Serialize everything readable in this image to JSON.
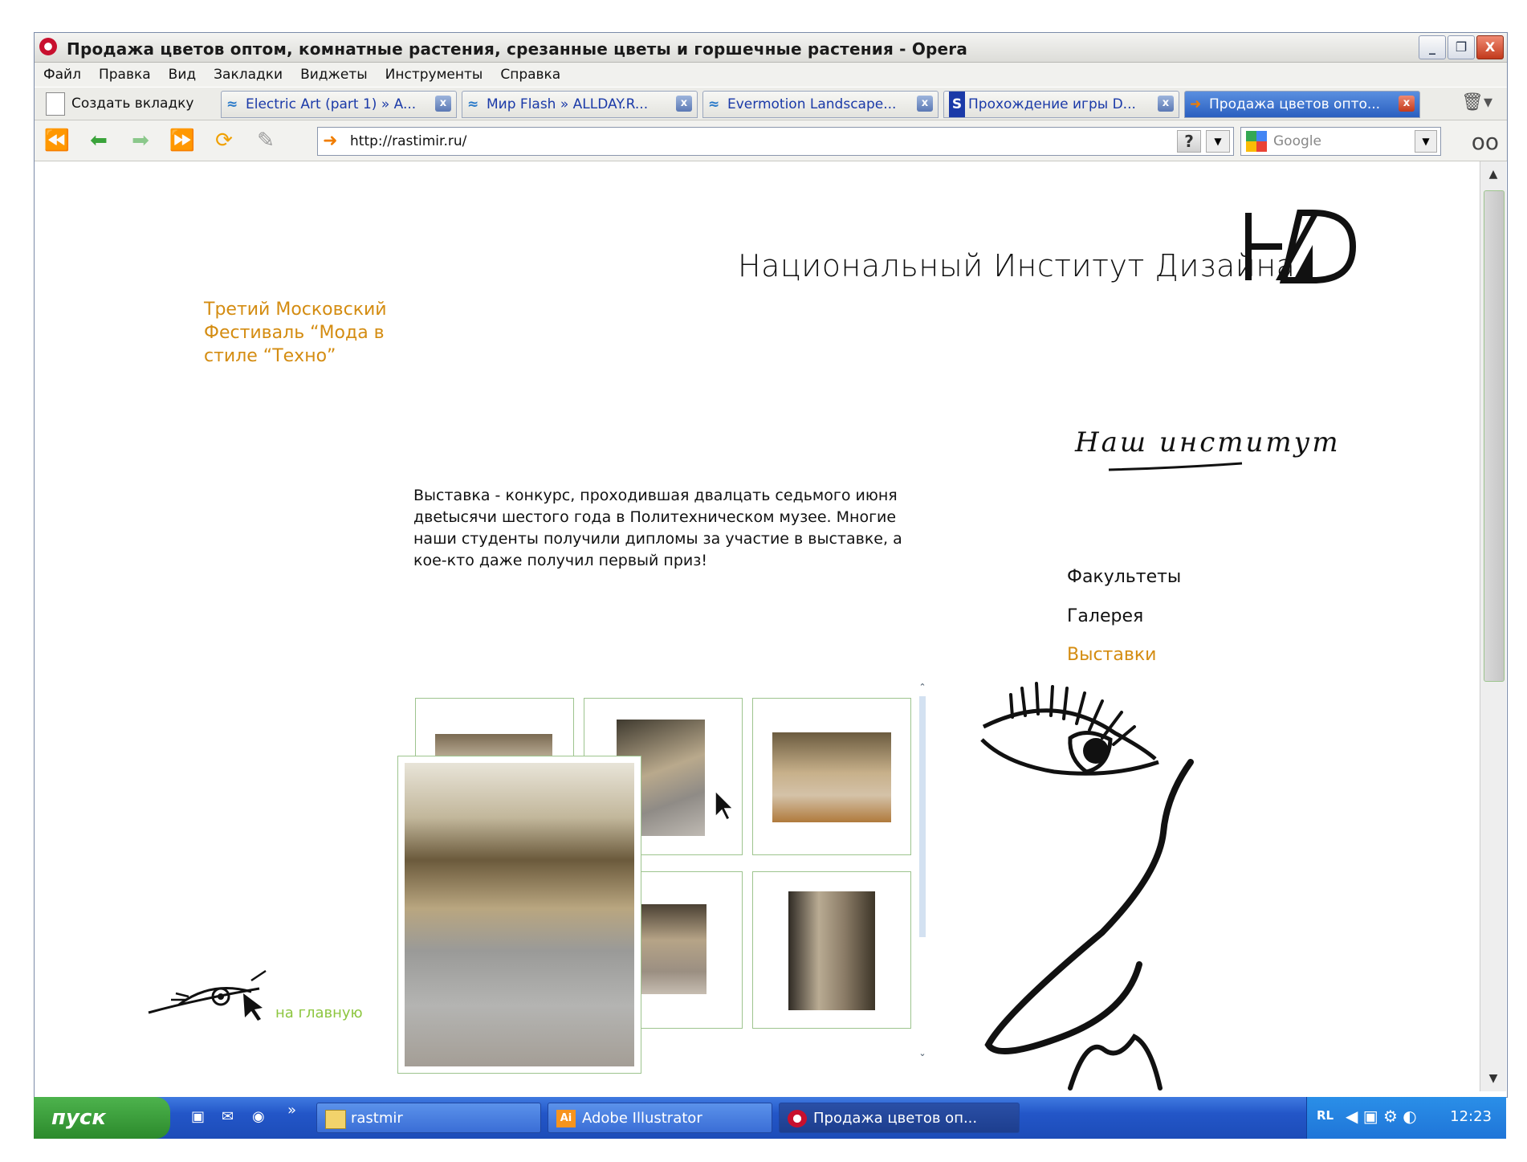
{
  "window": {
    "title": "Продажа цветов оптом, комнатные растения, срезанные цветы и горшечные растения - Opera",
    "minimize": "_",
    "maximize": "❐",
    "close": "X"
  },
  "menubar": [
    "Файл",
    "Правка",
    "Вид",
    "Закладки",
    "Виджеты",
    "Инструменты",
    "Справка"
  ],
  "tabs": {
    "new_tab": "Создать вкладку",
    "items": [
      {
        "label": "Electric Art (part 1) » A...",
        "icon": "wave-icon"
      },
      {
        "label": "Мир Flash » ALLDAY.R...",
        "icon": "wave-icon"
      },
      {
        "label": "Evermotion Landscape...",
        "icon": "wave-icon"
      },
      {
        "label": "Прохождение игры D...",
        "icon": "s-icon"
      },
      {
        "label": "Продажа цветов опто...",
        "icon": "arrow-icon"
      }
    ],
    "close": "x"
  },
  "address": {
    "url": "http://rastimir.ru/",
    "help": "?"
  },
  "search": {
    "placeholder": "Google"
  },
  "page": {
    "institute": "Национальный Институт Дизайна",
    "festival": "Третий Московский Фестиваль “Мода в стиле “Техно”",
    "description": "Выставка - конкурс, проходившая двалцать седьмого июня двеtысячи шестого года в Политехническом музее. Многие наши студенты получили дипломы за участие в выставке, а кое-кто даже получил первый приз!",
    "nav_heading": "Наш институт",
    "nav": [
      {
        "label": "Факультеты",
        "active": false
      },
      {
        "label": "Галерея",
        "active": false
      },
      {
        "label": "Выставки",
        "active": true
      }
    ],
    "home_link": "на главную"
  },
  "colors": {
    "accent_orange": "#d48c11",
    "accent_green": "#8dc63f",
    "thumb_border": "#9dc48e"
  },
  "taskbar": {
    "start": "пуск",
    "more": "»",
    "items": [
      {
        "label": "rastmir",
        "icon": "folder-icon"
      },
      {
        "label": "Adobe Illustrator",
        "icon": "illustrator-icon"
      },
      {
        "label": "Продажа цветов оп...",
        "icon": "opera-icon"
      }
    ],
    "lang": "RL",
    "clock": "12:23"
  }
}
